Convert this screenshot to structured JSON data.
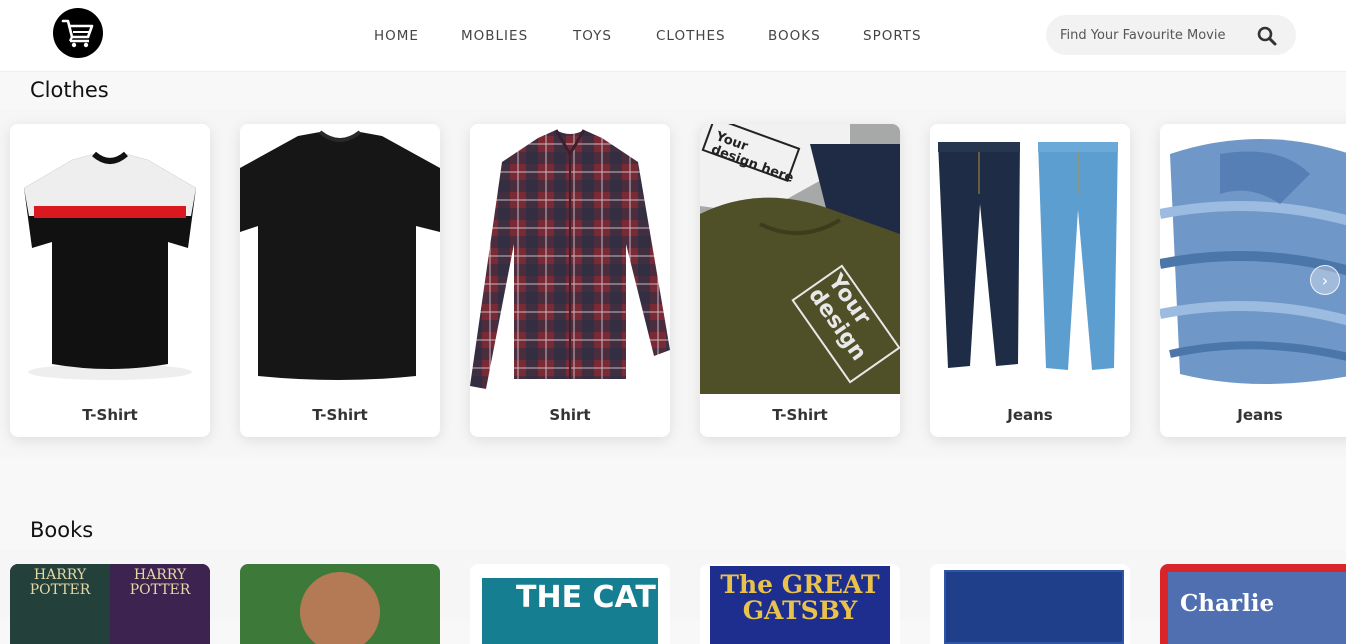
{
  "nav": {
    "links": [
      "HOME",
      "MOBLIES",
      "TOYS",
      "CLOTHES",
      "BOOKS",
      "SPORTS"
    ],
    "search_placeholder": "Find Your Favourite Movie"
  },
  "clothes": {
    "title": "Clothes",
    "items": [
      {
        "name": "T-Shirt"
      },
      {
        "name": "T-Shirt"
      },
      {
        "name": "Shirt"
      },
      {
        "name": "T-Shirt"
      },
      {
        "name": "Jeans"
      },
      {
        "name": "Jeans"
      }
    ],
    "prev_icon": "chevron-left-icon",
    "next_icon": "chevron-right-icon"
  },
  "books": {
    "title": "Books",
    "covers": [
      {
        "lines": [
          "HARRY",
          "POTTER",
          "HARRY",
          "POTTER"
        ]
      },
      {
        "lines": []
      },
      {
        "lines": [
          "THE CAT"
        ]
      },
      {
        "lines": [
          "The GREAT",
          "GATSBY"
        ]
      },
      {
        "lines": []
      },
      {
        "lines": [
          "Charlie"
        ]
      }
    ]
  },
  "colors": {
    "accent": "#000000",
    "text": "#333333"
  }
}
